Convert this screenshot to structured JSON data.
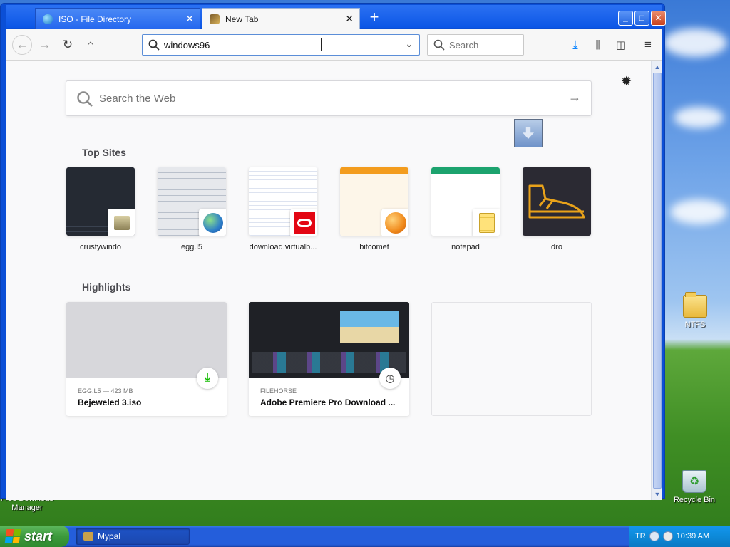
{
  "desktop": {
    "icons": [
      {
        "label": "NTFS"
      },
      {
        "label": "Recycle Bin"
      },
      {
        "label": "Free Download Manager"
      }
    ]
  },
  "taskbar": {
    "start_label": "start",
    "task_label": "Mypal",
    "tray_lang": "TR",
    "clock": "10:39 AM"
  },
  "browser": {
    "tabs": [
      {
        "label": "ISO - File Directory",
        "active": false
      },
      {
        "label": "New Tab",
        "active": true
      }
    ],
    "url_value": "windows96",
    "search_placeholder": "Search",
    "web_search_placeholder": "Search the Web"
  },
  "newtab": {
    "top_sites_title": "Top Sites",
    "top_sites": [
      {
        "label": "crustywindo"
      },
      {
        "label": "egg.l5"
      },
      {
        "label": "download.virtualb..."
      },
      {
        "label": "bitcomet"
      },
      {
        "label": "notepad"
      },
      {
        "label": "dro"
      }
    ],
    "highlights_title": "Highlights",
    "highlights": [
      {
        "context": "EGG.L5 — 423 MB",
        "title": "Bejeweled 3.iso"
      },
      {
        "context": "FILEHORSE",
        "title": "Adobe Premiere Pro Download ..."
      }
    ]
  },
  "colors": {
    "taskbar_blue": "#245edb",
    "start_green": "#3c9a3c",
    "titlebar_blue": "#0c56e6",
    "download_green": "#12bc00"
  }
}
